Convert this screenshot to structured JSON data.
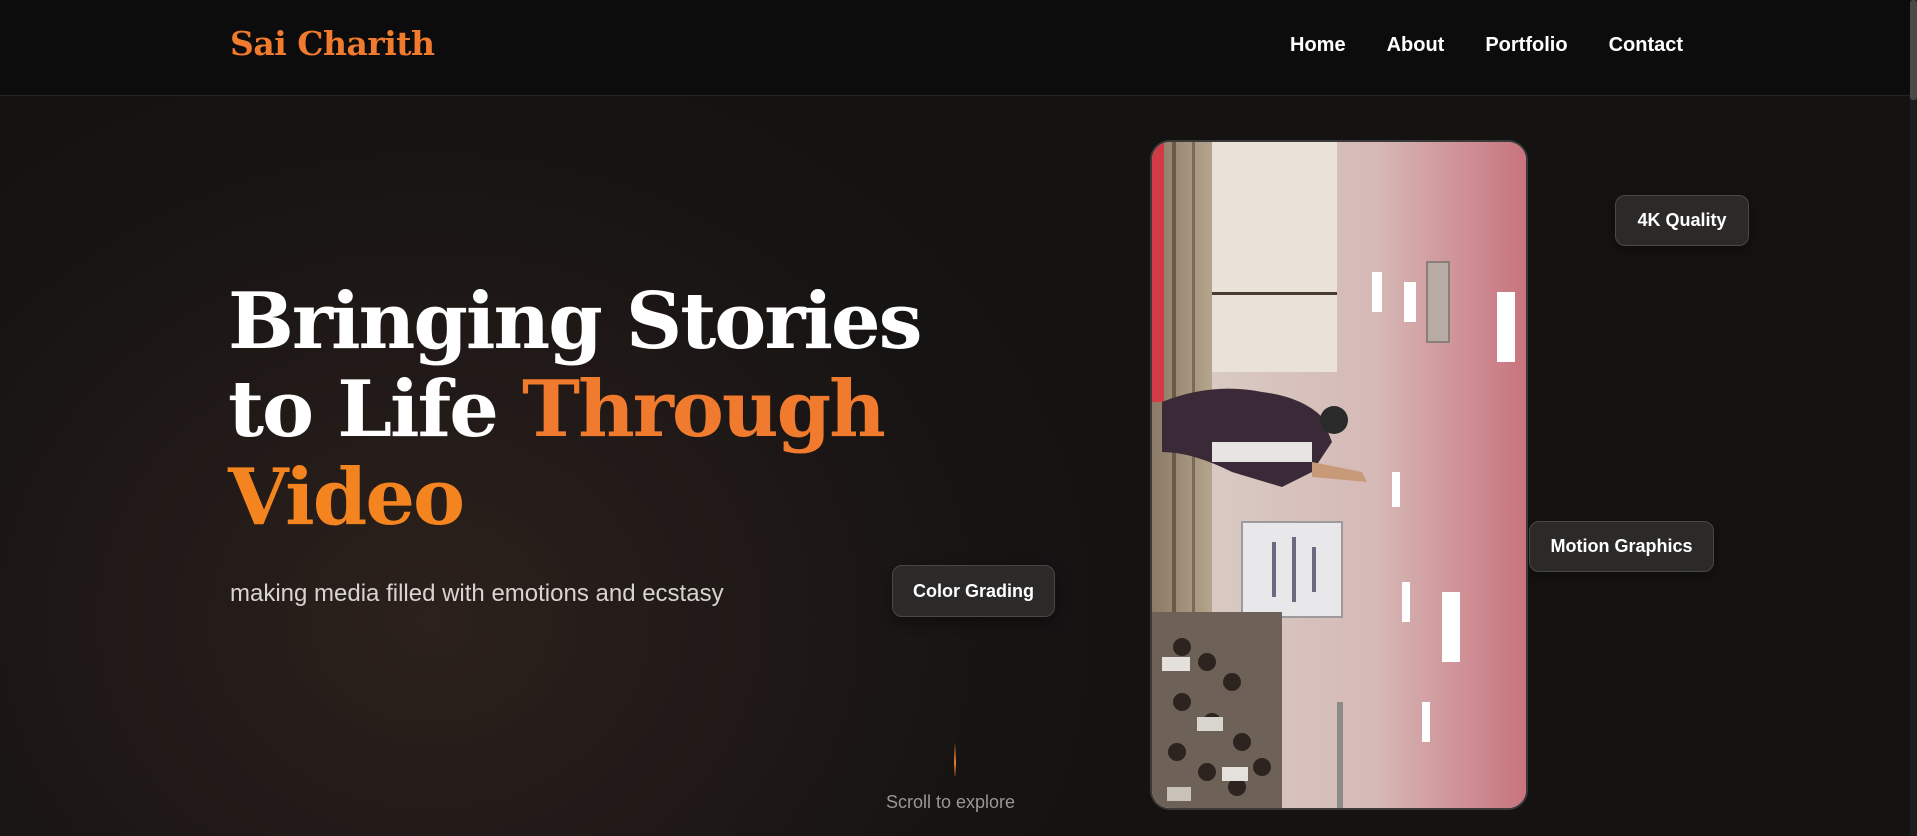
{
  "header": {
    "logo": "Sai Charith",
    "nav": [
      "Home",
      "About",
      "Portfolio",
      "Contact"
    ]
  },
  "hero": {
    "title_line1": "Bringing Stories",
    "title_line2_plain": "to Life ",
    "title_line2_accent": "Through",
    "title_line3_accent": "Video",
    "subtitle": "making media filled with emotions and ecstasy"
  },
  "badges": {
    "color_grading": "Color Grading",
    "quality": "4K Quality",
    "motion": "Motion Graphics"
  },
  "scroll": {
    "label": "Scroll to explore"
  },
  "colors": {
    "accent": "#f07a2e",
    "background": "#151312",
    "header": "#0c0c0c"
  }
}
